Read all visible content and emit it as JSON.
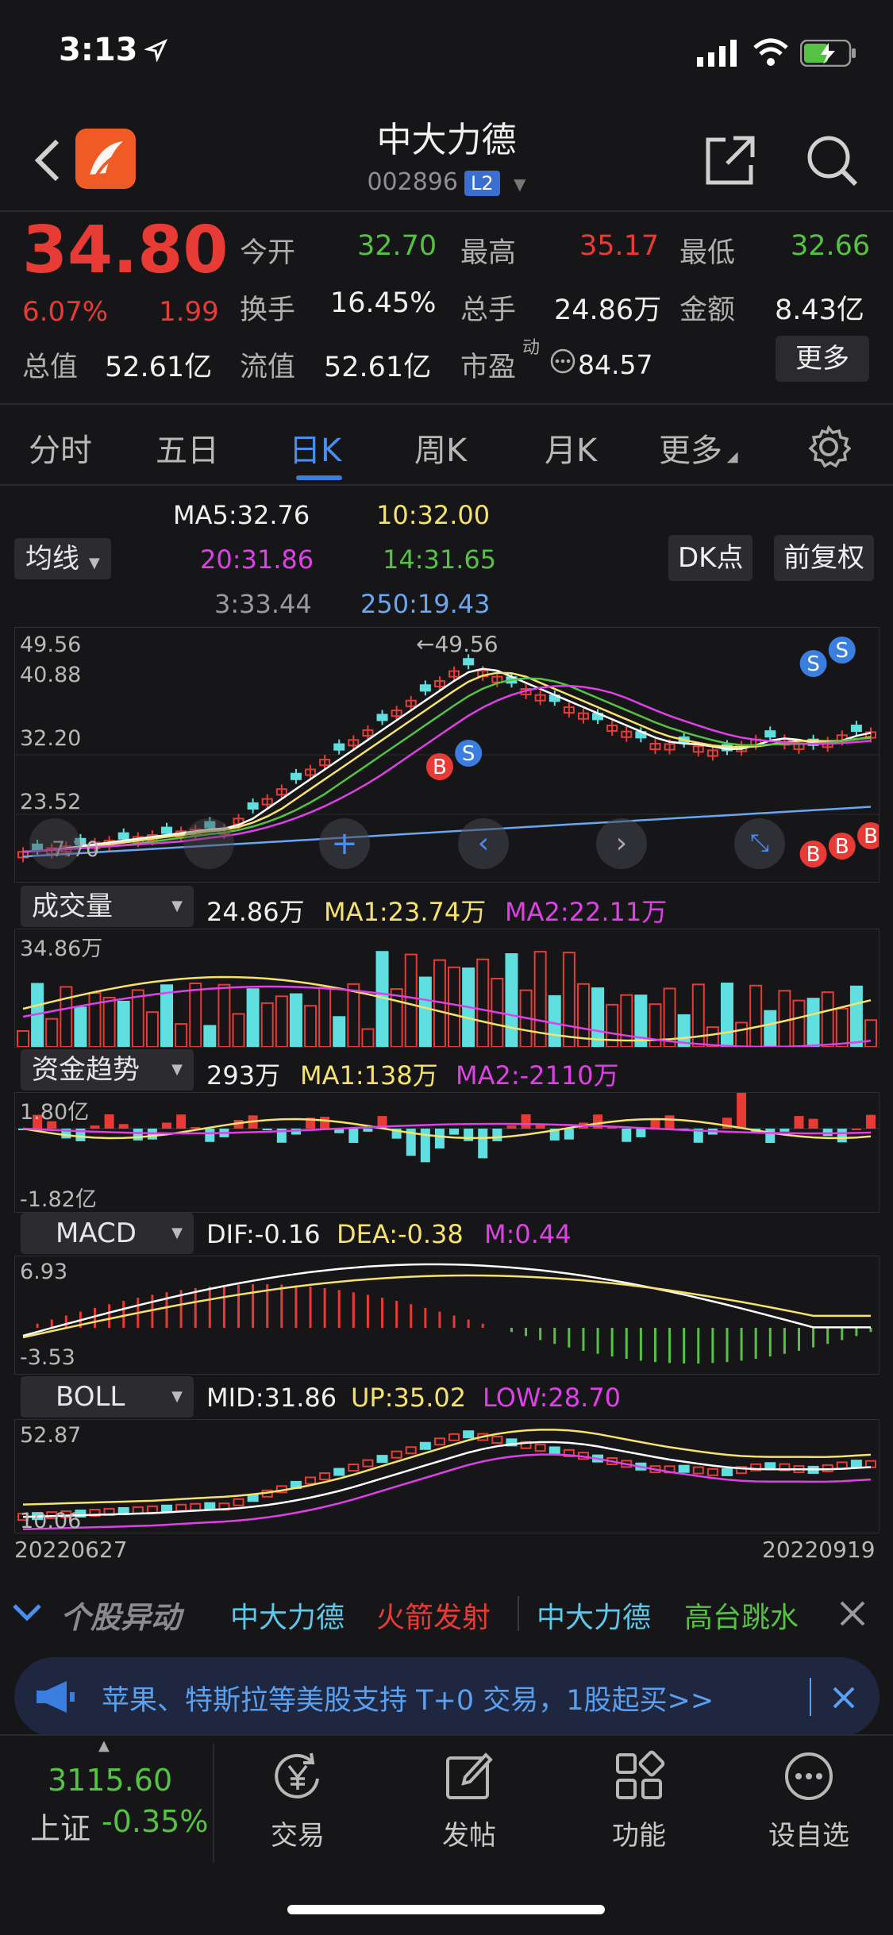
{
  "status": {
    "time": "3:13"
  },
  "header": {
    "title": "中大力德",
    "code": "002896",
    "l2": "L2"
  },
  "quote": {
    "price": "34.80",
    "change_pct": "6.07%",
    "change": "1.99",
    "fields": [
      {
        "label": "今开",
        "value": "32.70",
        "color": "green"
      },
      {
        "label": "最高",
        "value": "35.17",
        "color": "red"
      },
      {
        "label": "最低",
        "value": "32.66",
        "color": "green"
      },
      {
        "label": "换手",
        "value": "16.45%",
        "color": "white"
      },
      {
        "label": "总手",
        "value": "24.86万",
        "color": "white"
      },
      {
        "label": "金额",
        "value": "8.43亿",
        "color": "white"
      },
      {
        "label": "总值",
        "value": "52.61亿",
        "color": "white"
      },
      {
        "label": "流值",
        "value": "52.61亿",
        "color": "white"
      },
      {
        "label": "市盈",
        "value": "84.57",
        "color": "white"
      }
    ],
    "pe_superscript": "动",
    "more_label": "更多"
  },
  "tabs": [
    "分时",
    "五日",
    "日K",
    "周K",
    "月K",
    "更多"
  ],
  "active_tab": "日K",
  "ma": {
    "selector": "均线",
    "ma5": "MA5:32.76",
    "ma10": "10:32.00",
    "ma20": "20:31.86",
    "ma14": "14:31.65",
    "ma3": "3:33.44",
    "ma250": "250:19.43",
    "dk_button": "DK点",
    "fq_button": "前复权"
  },
  "kline": {
    "y_labels": [
      "49.56",
      "40.88",
      "32.20",
      "23.52"
    ],
    "peak_label": "←49.56",
    "bottom_label": "7.70"
  },
  "volume": {
    "selector": "成交量",
    "value": "24.86万",
    "ma1": "MA1:23.74万",
    "ma2": "MA2:22.11万",
    "y_top": "34.86万"
  },
  "fund": {
    "selector": "资金趋势",
    "value": "293万",
    "ma1": "MA1:138万",
    "ma2": "MA2:-2110万",
    "y_top": "1.80亿",
    "y_bottom": "-1.82亿"
  },
  "macd": {
    "selector": "MACD",
    "dif": "DIF:-0.16",
    "dea": "DEA:-0.38",
    "m": "M:0.44",
    "y_top": "6.93",
    "y_bottom": "-3.53"
  },
  "boll": {
    "selector": "BOLL",
    "mid": "MID:31.86",
    "up": "UP:35.02",
    "low": "LOW:28.70",
    "y_top": "52.87",
    "y_bottom": "10.06",
    "date_start": "20220627",
    "date_end": "20220919"
  },
  "ticker": {
    "title": "个股异动",
    "items": [
      {
        "stock": "中大力德",
        "event": "火箭发射",
        "event_color": "red"
      },
      {
        "stock": "中大力德",
        "event": "高台跳水",
        "event_color": "green"
      }
    ]
  },
  "banner": {
    "text": "苹果、特斯拉等美股支持 T+0 交易，1股起买>>"
  },
  "bottom": {
    "index_value": "3115.60",
    "index_name": "上证",
    "index_change": "-0.35%",
    "items": [
      "交易",
      "发帖",
      "功能",
      "设自选"
    ]
  },
  "colors": {
    "up": "#e83b36",
    "down": "#5fdfe0",
    "accent": "#4a8ff0",
    "ma5": "#ffffff",
    "ma10": "#f5e36c",
    "ma20": "#e040e8",
    "ma14": "#56c244",
    "ma250": "#6aa7f0"
  }
}
